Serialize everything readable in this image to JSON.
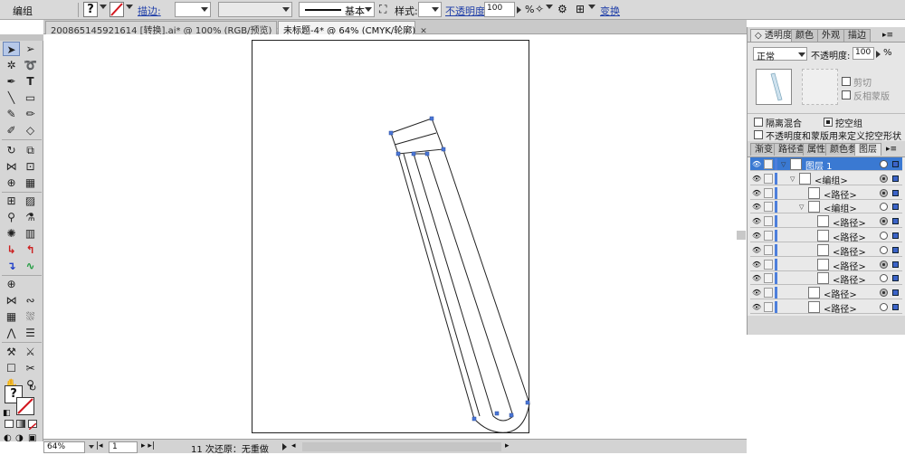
{
  "control_bar": {
    "selection_label": "编组",
    "stroke_label": "描边:",
    "brush_label": "基本",
    "style_label": "样式:",
    "opacity_label": "不透明度:",
    "opacity_value": "100",
    "opacity_unit": "%",
    "transform_label": "变换"
  },
  "tabs": [
    {
      "label": "200865145921614  [转换].ai* @ 100% (RGB/预览)",
      "close": "✕"
    },
    {
      "label": "未标题-4* @ 64% (CMYK/轮廓)",
      "close": "✕"
    }
  ],
  "transparency_panel": {
    "tabs": [
      "透明度",
      "颜色",
      "外观",
      "描边"
    ],
    "collapse_icon": "◇",
    "blend_mode": "正常",
    "opacity_label": "不透明度:",
    "opacity_value": "100",
    "opacity_unit": "%",
    "clip_label": "剪切",
    "invert_mask_label": "反相蒙版",
    "isolate_blend_label": "隔离混合",
    "knockout_group_label": "挖空组",
    "opacity_mask_label": "不透明度和蒙版用来定义挖空形状"
  },
  "layers_panel": {
    "tabs": [
      "渐变",
      "路径查",
      "属性",
      "颜色参",
      "图层"
    ],
    "rows": [
      {
        "name": "图层 1",
        "indent": 0,
        "expanded": true,
        "selected": true,
        "target_filled": false
      },
      {
        "name": "<编组>",
        "indent": 1,
        "expanded": true,
        "selected": false,
        "target_filled": true
      },
      {
        "name": "<路径>",
        "indent": 2,
        "expanded": false,
        "selected": false,
        "target_filled": true
      },
      {
        "name": "<编组>",
        "indent": 2,
        "expanded": true,
        "selected": false,
        "target_filled": false
      },
      {
        "name": "<路径>",
        "indent": 3,
        "expanded": false,
        "selected": false,
        "target_filled": true
      },
      {
        "name": "<路径>",
        "indent": 3,
        "expanded": false,
        "selected": false,
        "target_filled": false
      },
      {
        "name": "<路径>",
        "indent": 3,
        "expanded": false,
        "selected": false,
        "target_filled": false
      },
      {
        "name": "<路径>",
        "indent": 3,
        "expanded": false,
        "selected": false,
        "target_filled": true
      },
      {
        "name": "<路径>",
        "indent": 3,
        "expanded": false,
        "selected": false,
        "target_filled": false
      },
      {
        "name": "<路径>",
        "indent": 2,
        "expanded": false,
        "selected": false,
        "target_filled": true
      },
      {
        "name": "<路径>",
        "indent": 2,
        "expanded": false,
        "selected": false,
        "target_filled": false
      }
    ]
  },
  "status_bar": {
    "zoom": "64%",
    "artboard": "1",
    "undo_text": "11 次还原：无重做"
  }
}
